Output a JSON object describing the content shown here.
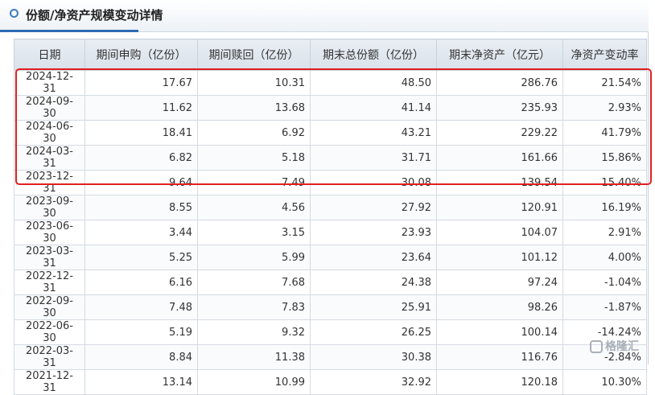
{
  "panel": {
    "title": "份额/净资产规模变动详情"
  },
  "table": {
    "headers": [
      "日期",
      "期间申购（亿份）",
      "期间赎回（亿份）",
      "期末总份额（亿份）",
      "期末净资产（亿元）",
      "净资产变动率"
    ],
    "rows": [
      [
        "2024-12-31",
        "17.67",
        "10.31",
        "48.50",
        "286.76",
        "21.54%"
      ],
      [
        "2024-09-30",
        "11.62",
        "13.68",
        "41.14",
        "235.93",
        "2.93%"
      ],
      [
        "2024-06-30",
        "18.41",
        "6.92",
        "43.21",
        "229.22",
        "41.79%"
      ],
      [
        "2024-03-31",
        "6.82",
        "5.18",
        "31.71",
        "161.66",
        "15.86%"
      ],
      [
        "2023-12-31",
        "9.64",
        "7.49",
        "30.08",
        "139.54",
        "15.40%"
      ],
      [
        "2023-09-30",
        "8.55",
        "4.56",
        "27.92",
        "120.91",
        "16.19%"
      ],
      [
        "2023-06-30",
        "3.44",
        "3.15",
        "23.93",
        "104.07",
        "2.91%"
      ],
      [
        "2023-03-31",
        "5.25",
        "5.99",
        "23.64",
        "101.12",
        "4.00%"
      ],
      [
        "2022-12-31",
        "6.16",
        "7.68",
        "24.38",
        "97.24",
        "-1.04%"
      ],
      [
        "2022-09-30",
        "7.48",
        "7.83",
        "25.91",
        "98.26",
        "-1.87%"
      ],
      [
        "2022-06-30",
        "5.19",
        "9.32",
        "26.25",
        "100.14",
        "-14.24%"
      ],
      [
        "2022-03-31",
        "8.84",
        "11.38",
        "30.38",
        "116.76",
        "-2.84%"
      ],
      [
        "2021-12-31",
        "13.14",
        "10.99",
        "32.92",
        "120.18",
        "10.30%"
      ]
    ]
  },
  "watermark": {
    "text": "格隆汇"
  }
}
